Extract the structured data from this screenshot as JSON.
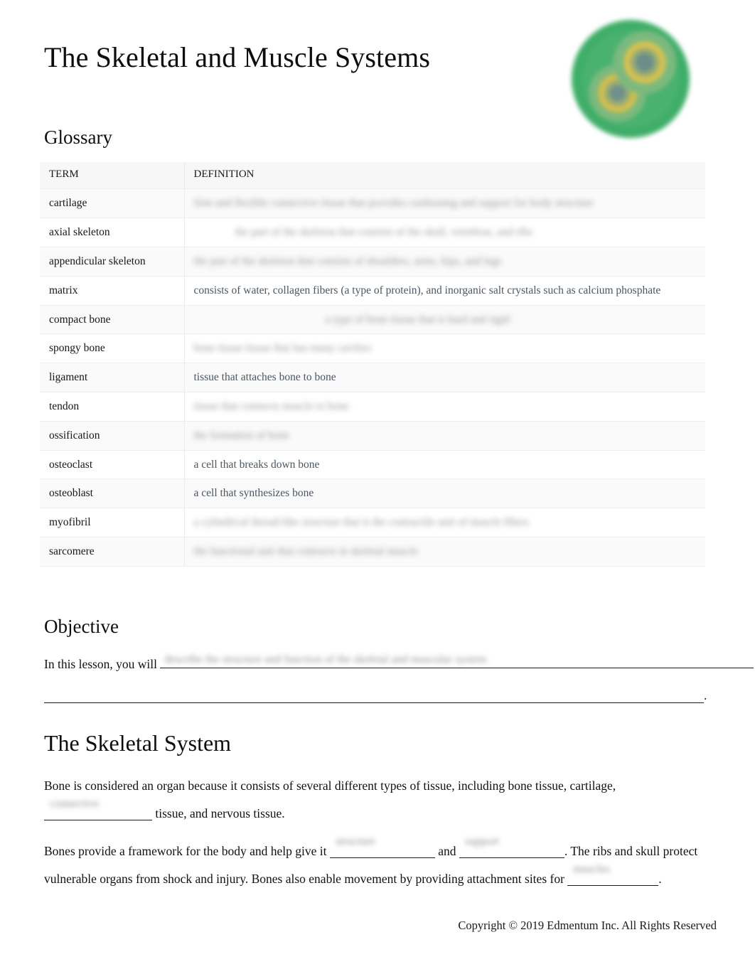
{
  "document": {
    "title": "The Skeletal and Muscle Systems",
    "logo_icon": "cell-biology-logo-icon"
  },
  "glossary": {
    "heading": "Glossary",
    "columns": [
      "TERM",
      "DEFINITION"
    ],
    "rows": [
      {
        "term": "cartilage",
        "definition": "firm and flexible connective tissue that provides cushioning and support for body structure",
        "redacted": true,
        "align": "left"
      },
      {
        "term": "axial skeleton",
        "definition": "the part of the skeleton that consists of the skull, vertebrae, and ribs",
        "redacted": true,
        "align": "indent"
      },
      {
        "term": "appendicular skeleton",
        "definition": "the part of the skeleton that consists of shoulders, arms, hips, and legs",
        "redacted": true,
        "align": "left"
      },
      {
        "term": "matrix",
        "definition": "consists of water, collagen fibers (a type of protein), and inorganic salt crystals such as calcium phosphate",
        "redacted": false,
        "align": "left"
      },
      {
        "term": "compact bone",
        "definition": "a type of bone tissue that is hard and rigid",
        "redacted": true,
        "align": "center"
      },
      {
        "term": "spongy bone",
        "definition": "bone tissue tissue that has many cavities",
        "redacted": true,
        "align": "left"
      },
      {
        "term": "ligament",
        "definition": "tissue that attaches bone to bone",
        "redacted": false,
        "align": "left"
      },
      {
        "term": "tendon",
        "definition": "tissue that connects muscle to bone",
        "redacted": true,
        "align": "left"
      },
      {
        "term": "ossification",
        "definition": "the formation of bone",
        "redacted": true,
        "align": "left"
      },
      {
        "term": "osteoclast",
        "definition": "a cell that breaks down bone",
        "redacted": false,
        "align": "left"
      },
      {
        "term": "osteoblast",
        "definition": "a cell that synthesizes bone",
        "redacted": false,
        "align": "left"
      },
      {
        "term": "myofibril",
        "definition": "a cylindrical thread-like structure that is the contractile unit of muscle fibers",
        "redacted": true,
        "align": "left"
      },
      {
        "term": "sarcomere",
        "definition": "the functional unit that contracts in skeletal muscle",
        "redacted": true,
        "align": "left"
      }
    ]
  },
  "objective": {
    "heading": "Objective",
    "prompt": "In this lesson, you will",
    "answer": "describe the structure and function of the skeletal and muscular system",
    "terminator": "."
  },
  "skeletal_system": {
    "heading": "The Skeletal System",
    "paragraph1": {
      "part1": "Bone is considered an organ because it consists of several different types of tissue, including bone tissue,",
      "part2": "cartilage,",
      "blank1_answer": "connective",
      "part3": "tissue, and nervous tissue."
    },
    "paragraph2": {
      "part1": "Bones provide a framework for the body and help give it",
      "blank1_answer": "structure",
      "conjunction": "and",
      "blank2_answer": "support",
      "part2": ". The ribs and skull protect vulnerable organs from shock and injury. Bones also enable movement by providing attachment sites for",
      "blank3_answer": "muscles",
      "terminator": "."
    }
  },
  "footer": {
    "copyright": "Copyright © 2019 Edmentum Inc. All Rights Reserved"
  }
}
